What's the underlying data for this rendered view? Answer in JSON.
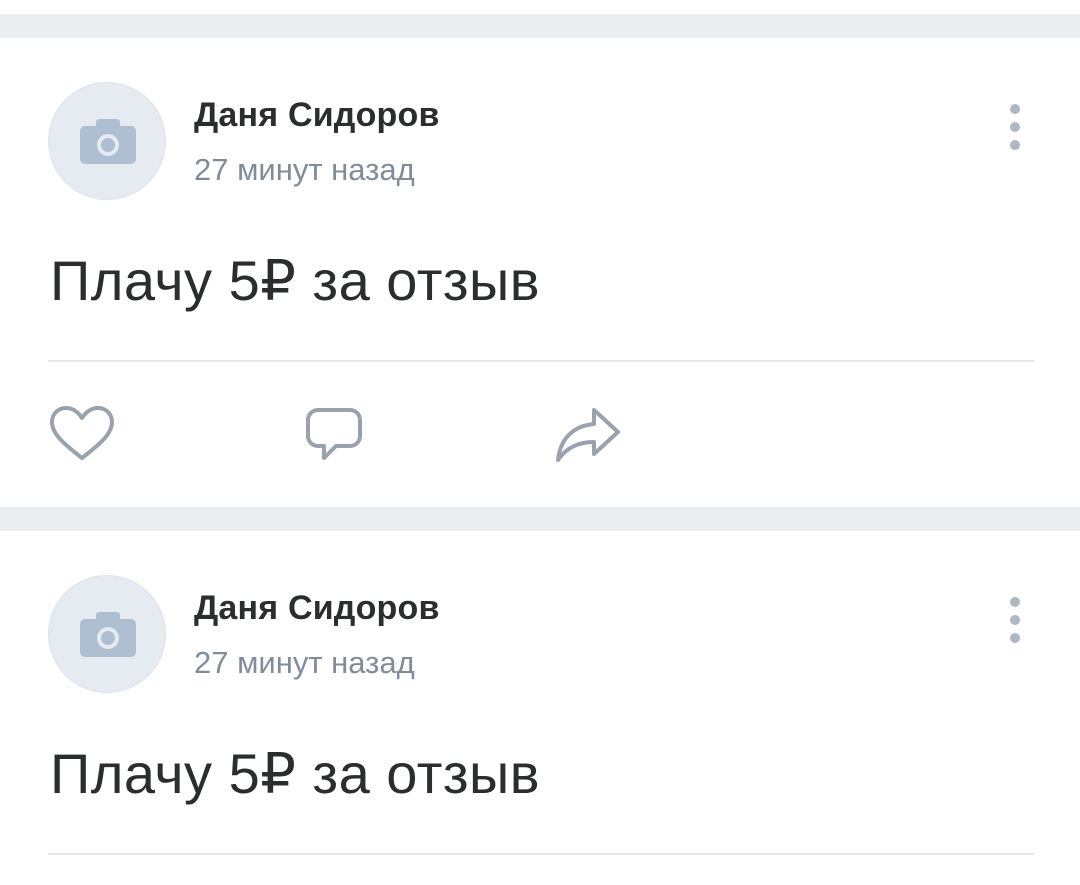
{
  "colors": {
    "separator": "#ebedf0",
    "author_text": "#2c2d2e",
    "meta_text": "#818c99",
    "icon": "#99a2ad",
    "avatar_bg": "#e5ebf1",
    "avatar_icon": "#aebfd2"
  },
  "posts": [
    {
      "author": "Даня Сидоров",
      "time": "27 минут назад",
      "text": "Плачу 5₽ за отзыв",
      "avatar_icon": "camera-icon",
      "menu_icon": "more-vertical-icon",
      "actions": [
        {
          "icon": "heart-icon"
        },
        {
          "icon": "comment-icon"
        },
        {
          "icon": "share-icon"
        }
      ]
    },
    {
      "author": "Даня Сидоров",
      "time": "27 минут назад",
      "text": "Плачу 5₽ за отзыв",
      "avatar_icon": "camera-icon",
      "menu_icon": "more-vertical-icon"
    }
  ]
}
